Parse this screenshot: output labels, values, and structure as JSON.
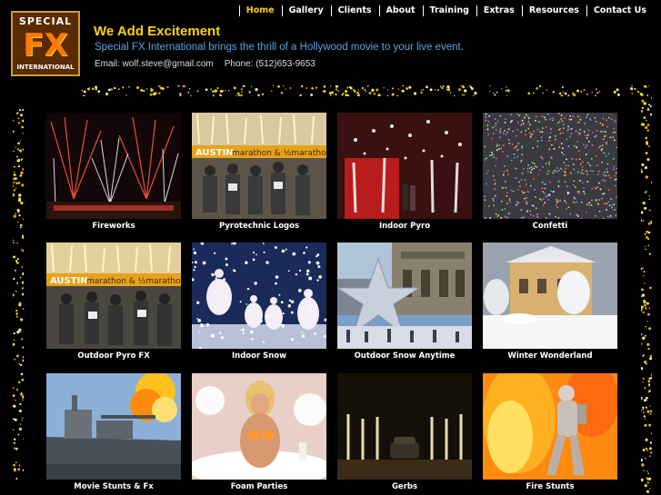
{
  "logo": {
    "top": "SPECIAL",
    "mid": "FX",
    "bottom": "INTERNATIONAL"
  },
  "nav": [
    {
      "label": "Home",
      "active": true
    },
    {
      "label": "Gallery"
    },
    {
      "label": "Clients"
    },
    {
      "label": "About"
    },
    {
      "label": "Training"
    },
    {
      "label": "Extras"
    },
    {
      "label": "Resources"
    },
    {
      "label": "Contact Us"
    }
  ],
  "header": {
    "headline": "We Add Excitement",
    "tagline": "Special FX International brings the thrill of a Hollywood movie to your live event.",
    "email_label": "Email: wolf.steve@gmail.com",
    "phone_label": "Phone: (512)653-9653"
  },
  "gallery": [
    {
      "caption": "Fireworks",
      "icon": "fireworks-image"
    },
    {
      "caption": "Pyrotechnic Logos",
      "icon": "marathon-pyro-image"
    },
    {
      "caption": "Indoor Pyro",
      "icon": "indoor-pyro-image"
    },
    {
      "caption": "Confetti",
      "icon": "confetti-image"
    },
    {
      "caption": "Outdoor Pyro FX",
      "icon": "marathon-runners-image"
    },
    {
      "caption": "Indoor Snow",
      "icon": "ballet-snow-image"
    },
    {
      "caption": "Outdoor Snow Anytime",
      "icon": "star-monument-image"
    },
    {
      "caption": "Winter Wonderland",
      "icon": "snowy-house-image"
    },
    {
      "caption": "Movie Stunts & Fx",
      "icon": "battleship-explosion-image"
    },
    {
      "caption": "Foam Parties",
      "icon": "foam-party-image"
    },
    {
      "caption": "Gerbs",
      "icon": "gerbs-image"
    },
    {
      "caption": "Fire Stunts",
      "icon": "fire-stunt-image"
    }
  ]
}
